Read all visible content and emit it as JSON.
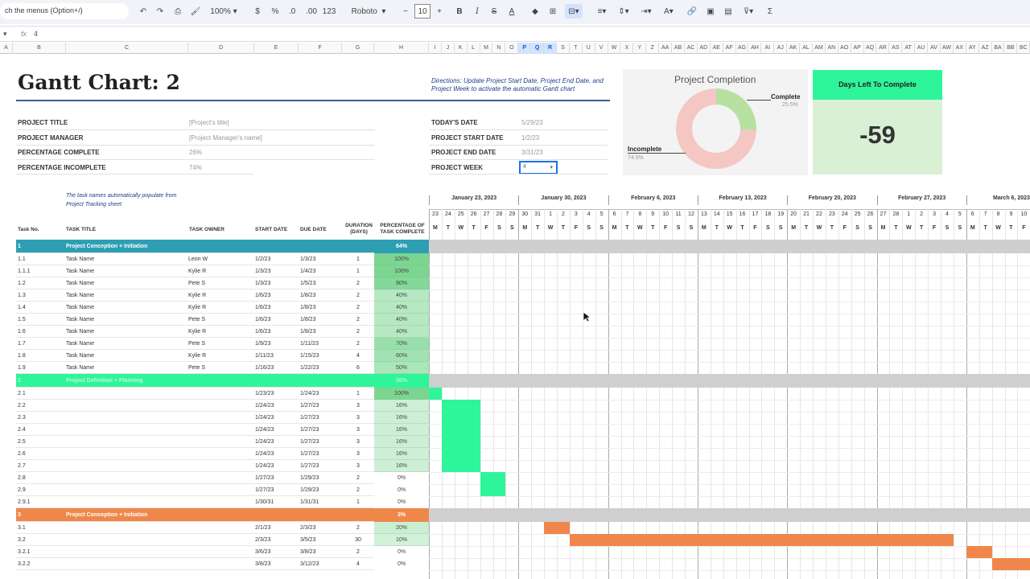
{
  "toolbar": {
    "search_text": "ch the menus (Option+/)",
    "zoom": "100%",
    "currency": "$",
    "percent": "%",
    "dec_minus": ".0",
    "dec_plus": ".00",
    "number_format": "123",
    "font": "Roboto",
    "font_size": "10",
    "minus": "−",
    "plus": "+"
  },
  "formula_bar": {
    "cell_ref": "",
    "fx": "fx",
    "value": "4"
  },
  "columns": [
    "A",
    "B",
    "C",
    "D",
    "E",
    "F",
    "G",
    "H",
    "I",
    "J",
    "K",
    "L",
    "M",
    "N",
    "O",
    "P",
    "Q",
    "R",
    "S",
    "T",
    "U",
    "V",
    "W",
    "X",
    "Y",
    "Z",
    "AA",
    "AB",
    "AC",
    "AD",
    "AE",
    "AF",
    "AG",
    "AH",
    "AI",
    "AJ",
    "AK",
    "AL",
    "AM",
    "AN",
    "AO",
    "AP",
    "AQ",
    "AR",
    "AS",
    "AT",
    "AU",
    "AV",
    "AW",
    "AX",
    "AY",
    "AZ",
    "BA",
    "BB",
    "BC"
  ],
  "title": "Gantt Chart: 2",
  "directions": "Directions: Update Project Start Date, Project End Date, and Project Week to activate the automatic Gantt chart",
  "info_left": [
    {
      "label": "PROJECT TITLE",
      "value": "[Project's title]"
    },
    {
      "label": "PROJECT MANAGER",
      "value": "[Project Manager's name]"
    },
    {
      "label": "PERCENTAGE COMPLETE",
      "value": "26%"
    },
    {
      "label": "PERCENTAGE INCOMPLETE",
      "value": "74%"
    }
  ],
  "info_right": [
    {
      "label": "TODAY'S DATE",
      "value": "5/29/23"
    },
    {
      "label": "PROJECT START DATE",
      "value": "1/2/23"
    },
    {
      "label": "PROJECT END DATE",
      "value": "3/31/23"
    },
    {
      "label": "PROJECT WEEK",
      "value": "4"
    }
  ],
  "completion_chart": {
    "title": "Project Completion",
    "complete_label": "Complete",
    "complete_pct": "25.5%",
    "complete_value": 25.5,
    "incomplete_label": "Incomplete",
    "incomplete_pct": "74.5%",
    "incomplete_value": 74.5,
    "complete_color": "#b7e1a1",
    "incomplete_color": "#f4c7c3"
  },
  "days_left": {
    "label": "Days Left To Complete",
    "value": "-59"
  },
  "note": "The task names automatically populate from Project Tracking sheet",
  "table_headers": {
    "no": "Task No.",
    "title": "TASK TITLE",
    "owner": "TASK OWNER",
    "start": "START DATE",
    "due": "DUE DATE",
    "duration": "DURATION (DAYS)",
    "pct": "PERCENTAGE OF TASK COMPLETE"
  },
  "weeks": [
    "January 23, 2023",
    "January 30, 2023",
    "February 6, 2023",
    "February 13, 2023",
    "February 20, 2023",
    "February 27, 2023",
    "March 6, 2023"
  ],
  "day_numbers": [
    "23",
    "24",
    "25",
    "26",
    "27",
    "28",
    "29",
    "30",
    "31",
    "1",
    "2",
    "3",
    "4",
    "5",
    "6",
    "7",
    "8",
    "9",
    "10",
    "11",
    "12",
    "13",
    "14",
    "15",
    "16",
    "17",
    "18",
    "19",
    "20",
    "21",
    "22",
    "23",
    "24",
    "25",
    "26",
    "27",
    "28",
    "1",
    "2",
    "3",
    "4",
    "5",
    "6",
    "7",
    "8",
    "9",
    "10"
  ],
  "day_letters": [
    "M",
    "T",
    "W",
    "T",
    "F",
    "S",
    "S",
    "M",
    "T",
    "W",
    "T",
    "F",
    "S",
    "S",
    "M",
    "T",
    "W",
    "T",
    "F",
    "S",
    "S",
    "M",
    "T",
    "W",
    "T",
    "F",
    "S",
    "S",
    "M",
    "T",
    "W",
    "T",
    "F",
    "S",
    "S",
    "M",
    "T",
    "W",
    "T",
    "F",
    "S",
    "S",
    "M",
    "T",
    "W",
    "T",
    "F"
  ],
  "phase_colors": [
    "#2e9fb3",
    "#2ef59a",
    "#f0874a"
  ],
  "rows": [
    {
      "type": "phase",
      "phase": 0,
      "no": "1",
      "title": "Project Conception + Initiation",
      "pct": "64%"
    },
    {
      "type": "task",
      "phase": 0,
      "no": "1.1",
      "title": "Task Name",
      "owner": "Leon W",
      "start": "1/2/23",
      "due": "1/3/23",
      "dur": "1",
      "pct": "100%",
      "pv": 100
    },
    {
      "type": "task",
      "phase": 0,
      "no": "1.1.1",
      "title": "Task Name",
      "owner": "Kylie R",
      "start": "1/3/23",
      "due": "1/4/23",
      "dur": "1",
      "pct": "100%",
      "pv": 100
    },
    {
      "type": "task",
      "phase": 0,
      "no": "1.2",
      "title": "Task Name",
      "owner": "Pete S",
      "start": "1/3/23",
      "due": "1/5/23",
      "dur": "2",
      "pct": "90%",
      "pv": 90
    },
    {
      "type": "task",
      "phase": 0,
      "no": "1.3",
      "title": "Task Name",
      "owner": "Kylie R",
      "start": "1/6/23",
      "due": "1/8/23",
      "dur": "2",
      "pct": "40%",
      "pv": 40
    },
    {
      "type": "task",
      "phase": 0,
      "no": "1.4",
      "title": "Task Name",
      "owner": "Kylie R",
      "start": "1/6/23",
      "due": "1/8/23",
      "dur": "2",
      "pct": "40%",
      "pv": 40
    },
    {
      "type": "task",
      "phase": 0,
      "no": "1.5",
      "title": "Task Name",
      "owner": "Pete S",
      "start": "1/6/23",
      "due": "1/8/23",
      "dur": "2",
      "pct": "40%",
      "pv": 40
    },
    {
      "type": "task",
      "phase": 0,
      "no": "1.6",
      "title": "Task Name",
      "owner": "Kylie R",
      "start": "1/6/23",
      "due": "1/8/23",
      "dur": "2",
      "pct": "40%",
      "pv": 40
    },
    {
      "type": "task",
      "phase": 0,
      "no": "1.7",
      "title": "Task Name",
      "owner": "Pete S",
      "start": "1/9/23",
      "due": "1/11/23",
      "dur": "2",
      "pct": "70%",
      "pv": 70
    },
    {
      "type": "task",
      "phase": 0,
      "no": "1.8",
      "title": "Task Name",
      "owner": "Kylie R",
      "start": "1/11/23",
      "due": "1/15/23",
      "dur": "4",
      "pct": "60%",
      "pv": 60
    },
    {
      "type": "task",
      "phase": 0,
      "no": "1.9",
      "title": "Task Name",
      "owner": "Pete S",
      "start": "1/16/23",
      "due": "1/22/23",
      "dur": "6",
      "pct": "50%",
      "pv": 50
    },
    {
      "type": "phase",
      "phase": 1,
      "no": "2",
      "title": "Project Definition + Planning",
      "pct": "30%"
    },
    {
      "type": "task",
      "phase": 1,
      "no": "2.1",
      "title": "",
      "owner": "",
      "start": "1/23/23",
      "due": "1/24/23",
      "dur": "1",
      "pct": "100%",
      "pv": 100
    },
    {
      "type": "task",
      "phase": 1,
      "no": "2.2",
      "title": "",
      "owner": "",
      "start": "1/24/23",
      "due": "1/27/23",
      "dur": "3",
      "pct": "16%",
      "pv": 16
    },
    {
      "type": "task",
      "phase": 1,
      "no": "2.3",
      "title": "",
      "owner": "",
      "start": "1/24/23",
      "due": "1/27/23",
      "dur": "3",
      "pct": "16%",
      "pv": 16
    },
    {
      "type": "task",
      "phase": 1,
      "no": "2.4",
      "title": "",
      "owner": "",
      "start": "1/24/23",
      "due": "1/27/23",
      "dur": "3",
      "pct": "16%",
      "pv": 16
    },
    {
      "type": "task",
      "phase": 1,
      "no": "2.5",
      "title": "",
      "owner": "",
      "start": "1/24/23",
      "due": "1/27/23",
      "dur": "3",
      "pct": "16%",
      "pv": 16
    },
    {
      "type": "task",
      "phase": 1,
      "no": "2.6",
      "title": "",
      "owner": "",
      "start": "1/24/23",
      "due": "1/27/23",
      "dur": "3",
      "pct": "16%",
      "pv": 16
    },
    {
      "type": "task",
      "phase": 1,
      "no": "2.7",
      "title": "",
      "owner": "",
      "start": "1/24/23",
      "due": "1/27/23",
      "dur": "3",
      "pct": "16%",
      "pv": 16
    },
    {
      "type": "task",
      "phase": 1,
      "no": "2.8",
      "title": "",
      "owner": "",
      "start": "1/27/23",
      "due": "1/29/23",
      "dur": "2",
      "pct": "0%",
      "pv": 0
    },
    {
      "type": "task",
      "phase": 1,
      "no": "2.9",
      "title": "",
      "owner": "",
      "start": "1/27/23",
      "due": "1/29/23",
      "dur": "2",
      "pct": "0%",
      "pv": 0
    },
    {
      "type": "task",
      "phase": 1,
      "no": "2.9.1",
      "title": "",
      "owner": "",
      "start": "1/30/31",
      "due": "1/31/31",
      "dur": "1",
      "pct": "0%",
      "pv": 0
    },
    {
      "type": "phase",
      "phase": 2,
      "no": "3",
      "title": "Project Conception + Initiation",
      "pct": "3%"
    },
    {
      "type": "task",
      "phase": 2,
      "no": "3.1",
      "title": "",
      "owner": "",
      "start": "2/1/23",
      "due": "2/3/23",
      "dur": "2",
      "pct": "20%",
      "pv": 20
    },
    {
      "type": "task",
      "phase": 2,
      "no": "3.2",
      "title": "",
      "owner": "",
      "start": "2/3/23",
      "due": "3/5/23",
      "dur": "30",
      "pct": "10%",
      "pv": 10
    },
    {
      "type": "task",
      "phase": 2,
      "no": "3.2.1",
      "title": "",
      "owner": "",
      "start": "3/6/23",
      "due": "3/8/23",
      "dur": "2",
      "pct": "0%",
      "pv": 0
    },
    {
      "type": "task",
      "phase": 2,
      "no": "3.2.2",
      "title": "",
      "owner": "",
      "start": "3/8/23",
      "due": "3/12/23",
      "dur": "4",
      "pct": "0%",
      "pv": 0
    }
  ]
}
